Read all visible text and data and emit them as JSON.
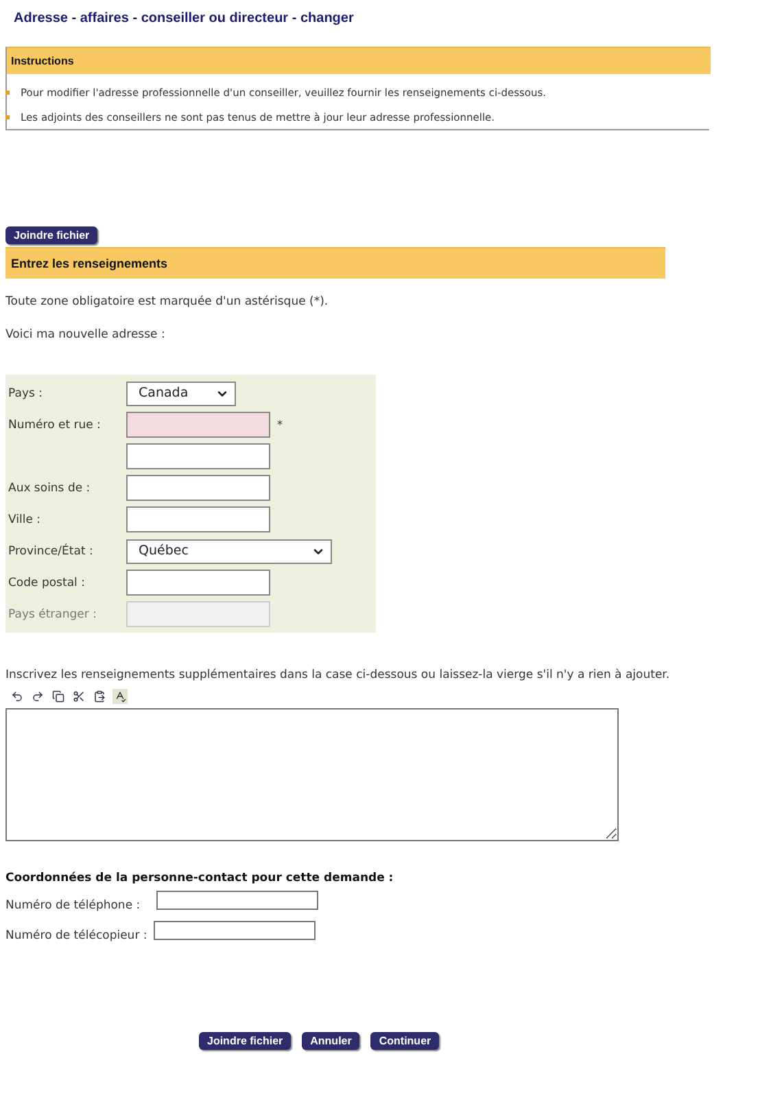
{
  "page_title": "Adresse - affaires - conseiller ou directeur - changer",
  "instructions": {
    "title": "Instructions",
    "items": [
      "Pour modifier l'adresse professionnelle d'un conseiller, veuillez fournir les renseignements ci-dessous.",
      "Les adjoints des conseillers ne sont pas tenus de mettre à jour leur adresse professionnelle."
    ]
  },
  "attach_button": "Joindre fichier",
  "section": {
    "title": "Entrez les renseignements"
  },
  "required_note": "Toute zone obligatoire est marquée d'un astérisque (*).",
  "address_intro": "Voici ma nouvelle adresse :",
  "address_fields": [
    {
      "label": "Pays :",
      "kind": "select",
      "value": "Canada",
      "wide": false
    },
    {
      "label": "Numéro et rue :",
      "kind": "text",
      "required": true,
      "mark": "*"
    },
    {
      "kind": "text",
      "required": false
    },
    {
      "label": "Aux soins de :",
      "kind": "text",
      "required": false
    },
    {
      "label": "Ville :",
      "kind": "text",
      "required": false
    },
    {
      "label": "Province/État :",
      "kind": "select",
      "value": "Québec",
      "wide": true
    },
    {
      "label": "Code postal :",
      "kind": "text",
      "required": false
    },
    {
      "label": "Pays étranger :",
      "kind": "text",
      "disabled": true,
      "required": false
    }
  ],
  "comments": {
    "text": "Inscrivez les renseignements supplémentaires dans la case ci-dessous ou laissez-la vierge s'il n'y a rien à ajouter.",
    "toolbar": [
      {
        "kind": "undo",
        "selected": false
      },
      {
        "kind": "redo",
        "selected": false
      },
      {
        "kind": "copy",
        "selected": false
      },
      {
        "kind": "cut",
        "selected": false
      },
      {
        "kind": "paste",
        "selected": false
      },
      {
        "kind": "spellcheck",
        "selected": true
      }
    ]
  },
  "contact": {
    "title": "Coordonnées de la personne-contact pour cette demande :",
    "fields": [
      {
        "label": "Numéro de téléphone :"
      },
      {
        "label": "Numéro de télécopieur :"
      }
    ]
  },
  "buttons": [
    "Joindre fichier",
    "Annuler",
    "Continuer"
  ]
}
